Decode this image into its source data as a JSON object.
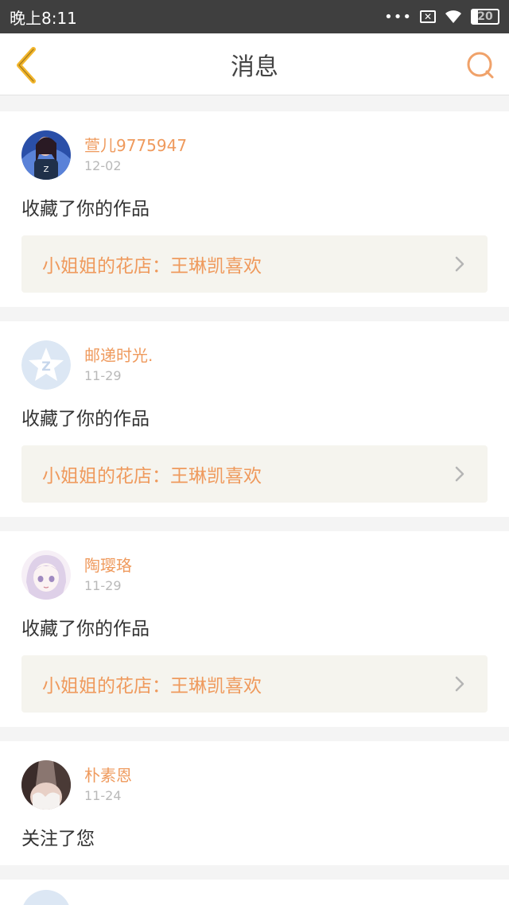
{
  "status_bar": {
    "time": "晚上8:11",
    "dots": "•••",
    "battery": "20"
  },
  "nav": {
    "title": "消息",
    "back_icon": "chevron-left-icon",
    "search_icon": "search-icon"
  },
  "colors": {
    "accent": "#ef9a5d",
    "back_icon": "#f3b62c",
    "link_bg": "#f5f4ee"
  },
  "messages": [
    {
      "username": "萱儿9775947",
      "date": "12-02",
      "action": "收藏了你的作品",
      "work_title": "小姐姐的花店：王琳凯喜欢"
    },
    {
      "username": "邮递时光.",
      "date": "11-29",
      "action": "收藏了你的作品",
      "work_title": "小姐姐的花店：王琳凯喜欢"
    },
    {
      "username": "陶璎珞",
      "date": "11-29",
      "action": "收藏了你的作品",
      "work_title": "小姐姐的花店：王琳凯喜欢"
    },
    {
      "username": "朴素恩",
      "date": "11-24",
      "action": "关注了您"
    }
  ]
}
